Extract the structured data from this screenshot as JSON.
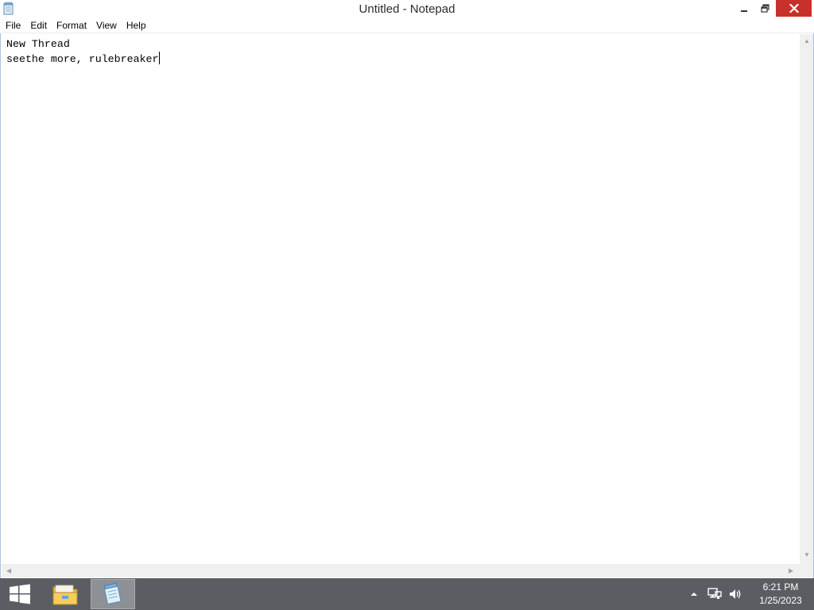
{
  "window": {
    "title": "Untitled - Notepad",
    "icon": "notepad-icon",
    "close_color": "#c7312b"
  },
  "menu": {
    "items": [
      {
        "label": "File"
      },
      {
        "label": "Edit"
      },
      {
        "label": "Format"
      },
      {
        "label": "View"
      },
      {
        "label": "Help"
      }
    ]
  },
  "editor": {
    "lines": [
      "New Thread",
      "seethe more, rulebreaker"
    ]
  },
  "taskbar": {
    "color": "#5a5e62",
    "apps": [
      {
        "name": "File Explorer",
        "icon": "folder-icon",
        "active": false
      },
      {
        "name": "Notepad",
        "icon": "notepad-icon",
        "active": true
      }
    ],
    "tray": {
      "icons": [
        "chevron-up-icon",
        "network-icon",
        "speaker-icon"
      ],
      "time": "6:21 PM",
      "date": "1/25/2023"
    }
  }
}
